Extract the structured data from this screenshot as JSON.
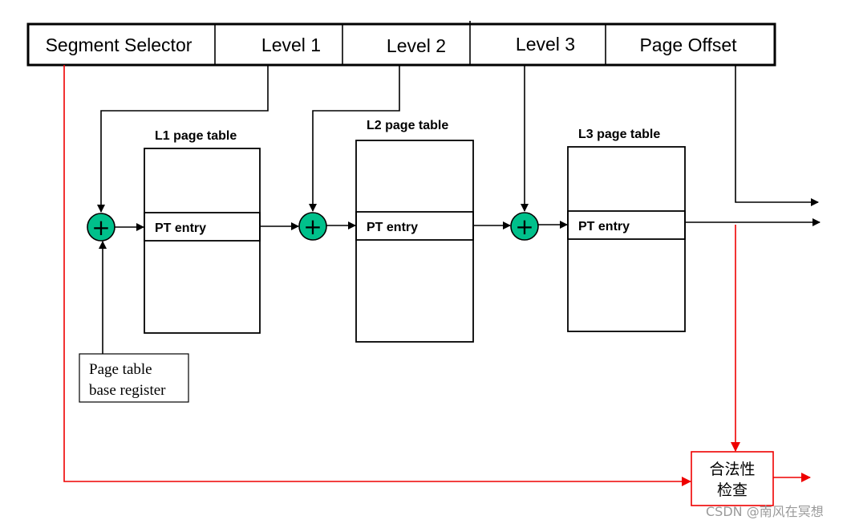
{
  "address_fields": [
    "Segment Selector",
    "Level 1",
    "Level 2",
    "Level 3",
    "Page Offset"
  ],
  "tables": [
    {
      "title": "L1 page table",
      "entry": "PT entry"
    },
    {
      "title": "L2 page table",
      "entry": "PT entry"
    },
    {
      "title": "L3 page table",
      "entry": "PT entry"
    }
  ],
  "adder_symbol": "+",
  "base_register": {
    "line1": "Page table",
    "line2": "base register"
  },
  "check_box": {
    "line1": "合法性",
    "line2": "检查"
  },
  "watermark": "CSDN @南风在冥想",
  "colors": {
    "adder": "#00c08b",
    "check_path": "#e00000",
    "lines": "#000000"
  }
}
